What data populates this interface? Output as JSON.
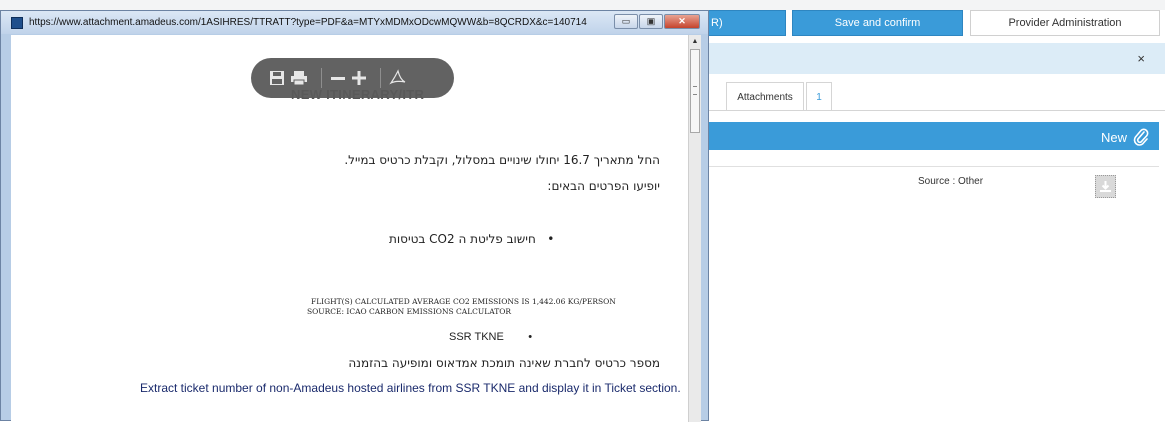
{
  "app": {
    "btn_partial_label": "R)",
    "save_confirm": "Save and confirm",
    "provider_admin": "Provider Administration",
    "close_symbol": "×",
    "tabs": [
      {
        "label": "Attachments"
      },
      {
        "label": "1"
      }
    ],
    "new_label": "New",
    "source_text": "Source : Other",
    "colors": {
      "accent": "#3a9bd9",
      "info_strip": "#dcecf7"
    }
  },
  "popup": {
    "url": "https://www.attachment.amadeus.com/1ASIHRES/TTRATT?type=PDF&a=MTYxMDMxODcwMQWW&b=8QCRDX&c=140714",
    "window_buttons": {
      "minimize": "▭",
      "maximize": "▣",
      "close": "✕"
    },
    "pdf_title": "NEW ITINERARY/ITR",
    "toolbar_icons": [
      "save-icon",
      "print-icon",
      "zoom-out-icon",
      "zoom-in-icon",
      "acrobat-icon"
    ],
    "lines": {
      "l1": "החל מתאריך 16.7 יחולו שינויים במסלול, וקבלת כרטיס במייל.",
      "l2": "יופיעו הפרטים הבאים:",
      "l3": "חישוב פליטת ה CO2 בטיסות",
      "mono1": "FLIGHT(S) CALCULATED AVERAGE CO2 EMISSIONS IS 1,442.06 KG/PERSON",
      "mono2": "SOURCE: ICAO CARBON EMISSIONS CALCULATOR",
      "l4": "SSR TKNE",
      "l5": "מספר כרטיס לחברת שאינה תומכת אמדאוס ומופיעה בהזמנה",
      "l6": "Extract ticket number of non-Amadeus hosted airlines from SSR TKNE and display it in Ticket section."
    }
  }
}
